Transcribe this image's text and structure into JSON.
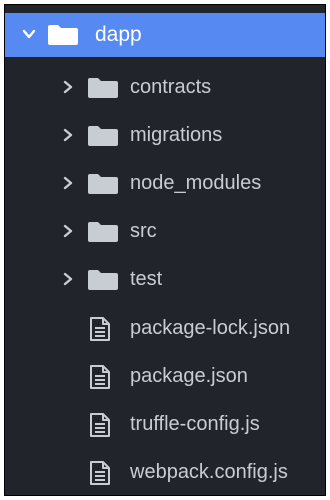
{
  "explorer": {
    "root": {
      "label": "dapp",
      "expanded": true,
      "icon": "folder-icon"
    },
    "items": [
      {
        "label": "contracts",
        "type": "folder",
        "icon": "folder-icon"
      },
      {
        "label": "migrations",
        "type": "folder",
        "icon": "folder-icon"
      },
      {
        "label": "node_modules",
        "type": "folder",
        "icon": "folder-icon"
      },
      {
        "label": "src",
        "type": "folder",
        "icon": "folder-icon"
      },
      {
        "label": "test",
        "type": "folder",
        "icon": "folder-icon"
      },
      {
        "label": "package-lock.json",
        "type": "file",
        "icon": "file-text-icon"
      },
      {
        "label": "package.json",
        "type": "file",
        "icon": "file-text-icon"
      },
      {
        "label": "truffle-config.js",
        "type": "file",
        "icon": "file-text-icon"
      },
      {
        "label": "webpack.config.js",
        "type": "file",
        "icon": "file-text-icon"
      }
    ]
  },
  "colors": {
    "background": "#21252b",
    "selection": "#568af2",
    "text": "#c8ccd3",
    "selected_text": "#ffffff",
    "icon": "#c8ccd3"
  }
}
